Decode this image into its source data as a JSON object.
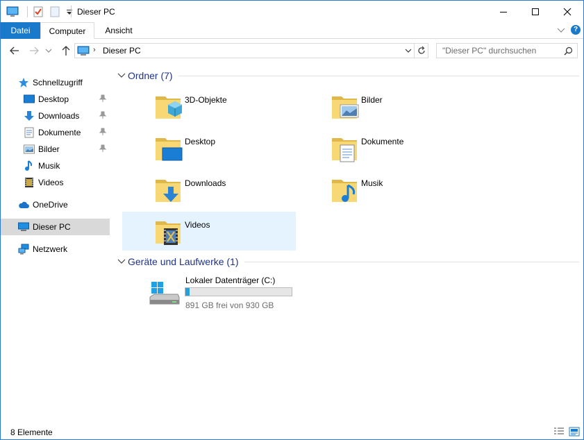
{
  "window": {
    "title": "Dieser PC"
  },
  "ribbon": {
    "tabs": [
      "Datei",
      "Computer",
      "Ansicht"
    ],
    "help": "?"
  },
  "address": {
    "path_item": "Dieser PC"
  },
  "search": {
    "placeholder": "\"Dieser PC\" durchsuchen"
  },
  "nav": {
    "quick_access": "Schnellzugriff",
    "quick_items": [
      {
        "label": "Desktop",
        "icon": "desktop-icon",
        "pinned": true
      },
      {
        "label": "Downloads",
        "icon": "downloads-icon",
        "pinned": true
      },
      {
        "label": "Dokumente",
        "icon": "documents-icon",
        "pinned": true
      },
      {
        "label": "Bilder",
        "icon": "pictures-icon",
        "pinned": true
      },
      {
        "label": "Musik",
        "icon": "music-icon",
        "pinned": false
      },
      {
        "label": "Videos",
        "icon": "videos-icon",
        "pinned": false
      }
    ],
    "onedrive": "OneDrive",
    "this_pc": "Dieser PC",
    "network": "Netzwerk"
  },
  "content": {
    "folders_header": "Ordner (7)",
    "folders": [
      {
        "label": "3D-Objekte",
        "icon": "3d-objects-folder-icon"
      },
      {
        "label": "Bilder",
        "icon": "pictures-folder-icon"
      },
      {
        "label": "Desktop",
        "icon": "desktop-folder-icon"
      },
      {
        "label": "Dokumente",
        "icon": "documents-folder-icon"
      },
      {
        "label": "Downloads",
        "icon": "downloads-folder-icon"
      },
      {
        "label": "Musik",
        "icon": "music-folder-icon"
      },
      {
        "label": "Videos",
        "icon": "videos-folder-icon",
        "selected": true
      }
    ],
    "drives_header": "Geräte und Laufwerke (1)",
    "drive": {
      "label": "Lokaler Datenträger (C:)",
      "free_text": "891 GB frei von 930 GB",
      "used_fraction": 0.042,
      "bar_color": "#26a0da"
    }
  },
  "status": {
    "count": "8 Elemente"
  },
  "colors": {
    "accent": "#1979ca",
    "group_header": "#1e3287",
    "selection": "#e5f3ff",
    "folder_yellow": "#f8d775"
  }
}
